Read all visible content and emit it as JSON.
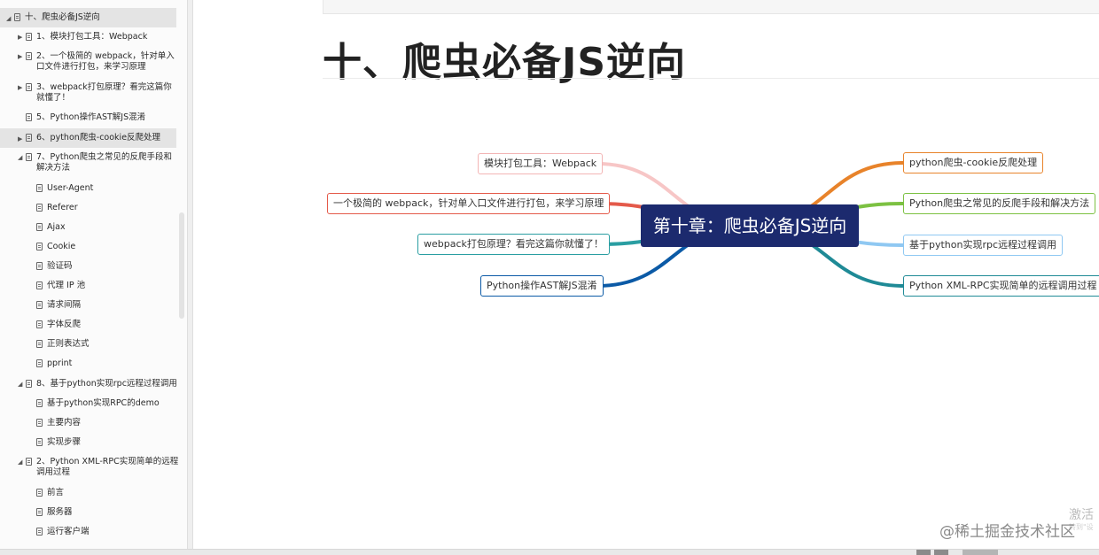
{
  "sidebar": {
    "items": [
      {
        "label": "十、爬虫必备JS逆向",
        "indent": 0,
        "arrow": "▲",
        "active": true
      },
      {
        "label": "1、模块打包工具：Webpack",
        "indent": 1,
        "arrow": "▶"
      },
      {
        "label": "2、一个极简的 webpack，针对单入",
        "label2": "口文件进行打包，来学习原理",
        "indent": 1,
        "arrow": "▶"
      },
      {
        "label": "3、webpack打包原理？看完这篇你",
        "label2": "就懂了！",
        "indent": 1,
        "arrow": "▶"
      },
      {
        "label": "5、Python操作AST解JS混淆",
        "indent": 1,
        "arrow": ""
      },
      {
        "label": "6、python爬虫-cookie反爬处理",
        "indent": 1,
        "arrow": "▶",
        "active": true
      },
      {
        "label": "7、Python爬虫之常见的反爬手段和",
        "label2": "解决方法",
        "indent": 1,
        "arrow": "▲"
      },
      {
        "label": "User-Agent",
        "indent": 2,
        "arrow": ""
      },
      {
        "label": "Referer",
        "indent": 2,
        "arrow": ""
      },
      {
        "label": "Ajax",
        "indent": 2,
        "arrow": ""
      },
      {
        "label": "Cookie",
        "indent": 2,
        "arrow": ""
      },
      {
        "label": "验证码",
        "indent": 2,
        "arrow": ""
      },
      {
        "label": "代理 IP 池",
        "indent": 2,
        "arrow": ""
      },
      {
        "label": "请求间隔",
        "indent": 2,
        "arrow": ""
      },
      {
        "label": "字体反爬",
        "indent": 2,
        "arrow": ""
      },
      {
        "label": "正则表达式",
        "indent": 2,
        "arrow": ""
      },
      {
        "label": "pprint",
        "indent": 2,
        "arrow": ""
      },
      {
        "label": "8、基于python实现rpc远程过程调用",
        "indent": 1,
        "arrow": "▲"
      },
      {
        "label": "基于python实现RPC的demo",
        "indent": 2,
        "arrow": ""
      },
      {
        "label": "主要内容",
        "indent": 2,
        "arrow": ""
      },
      {
        "label": "实现步骤",
        "indent": 2,
        "arrow": ""
      },
      {
        "label": "2、Python XML-RPC实现简单的远程",
        "label2": "调用过程",
        "indent": 1,
        "arrow": "▲"
      },
      {
        "label": "前言",
        "indent": 2,
        "arrow": ""
      },
      {
        "label": "服务器",
        "indent": 2,
        "arrow": ""
      },
      {
        "label": "运行客户端",
        "indent": 2,
        "arrow": ""
      }
    ]
  },
  "main": {
    "title": "十、爬虫必备JS逆向"
  },
  "mindmap": {
    "center": "第十章：爬虫必备JS逆向",
    "left": [
      {
        "label": "模块打包工具：Webpack",
        "color": "#f7c6c6"
      },
      {
        "label": "一个极简的 webpack，针对单入口文件进行打包，来学习原理",
        "color": "#e45a4a"
      },
      {
        "label": "webpack打包原理？看完这篇你就懂了！",
        "color": "#2a9ea2"
      },
      {
        "label": "Python操作AST解JS混淆",
        "color": "#0b5aa6"
      }
    ],
    "right": [
      {
        "label": "python爬虫-cookie反爬处理",
        "color": "#e8832a"
      },
      {
        "label": "Python爬虫之常见的反爬手段和解决方法",
        "color": "#7cc142"
      },
      {
        "label": "基于python实现rpc远程过程调用",
        "color": "#8fc8f2"
      },
      {
        "label": "Python XML-RPC实现简单的远程调用过程",
        "color": "#1f8a96"
      }
    ]
  },
  "watermark": {
    "activate": "激活",
    "activate_sub": "转到\"设",
    "site": "@稀土掘金技术社区"
  }
}
